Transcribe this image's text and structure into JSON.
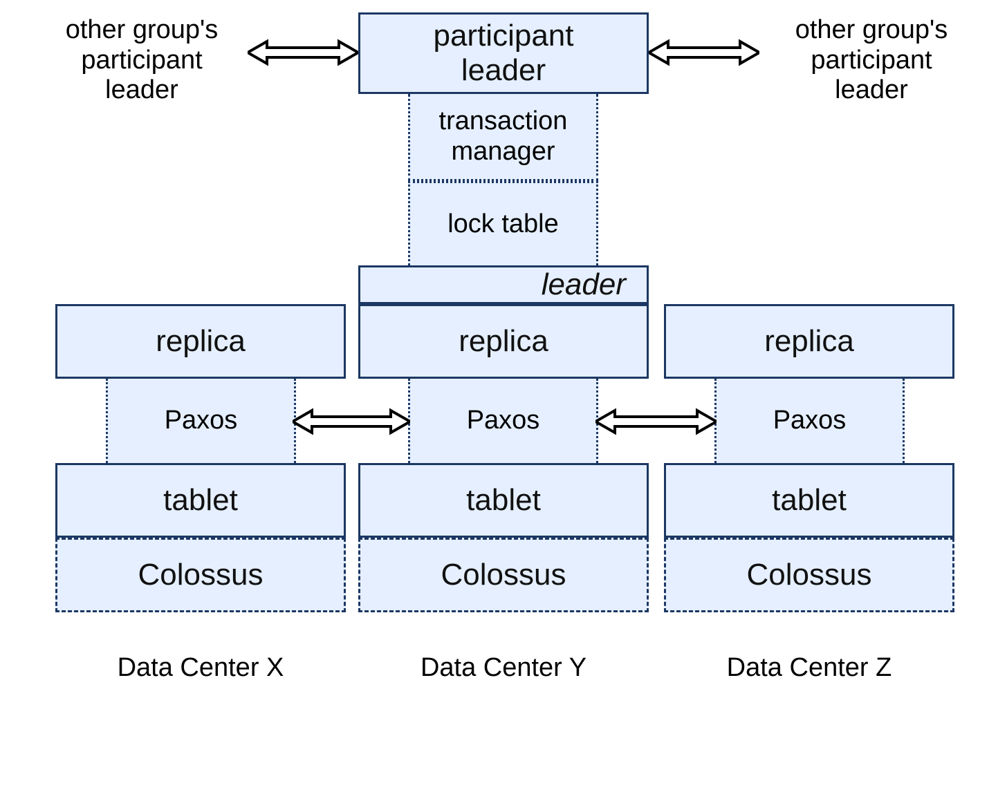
{
  "top": {
    "left_label": "other group's\nparticipant\nleader",
    "right_label": "other group's\nparticipant\nleader",
    "participant_leader": "participant\nleader",
    "transaction_manager": "transaction\nmanager",
    "lock_table": "lock table",
    "leader_strip": "leader"
  },
  "columns": [
    {
      "replica": "replica",
      "paxos": "Paxos",
      "tablet": "tablet",
      "colossus": "Colossus",
      "dc": "Data Center X"
    },
    {
      "replica": "replica",
      "paxos": "Paxos",
      "tablet": "tablet",
      "colossus": "Colossus",
      "dc": "Data Center Y"
    },
    {
      "replica": "replica",
      "paxos": "Paxos",
      "tablet": "tablet",
      "colossus": "Colossus",
      "dc": "Data Center Z"
    }
  ]
}
